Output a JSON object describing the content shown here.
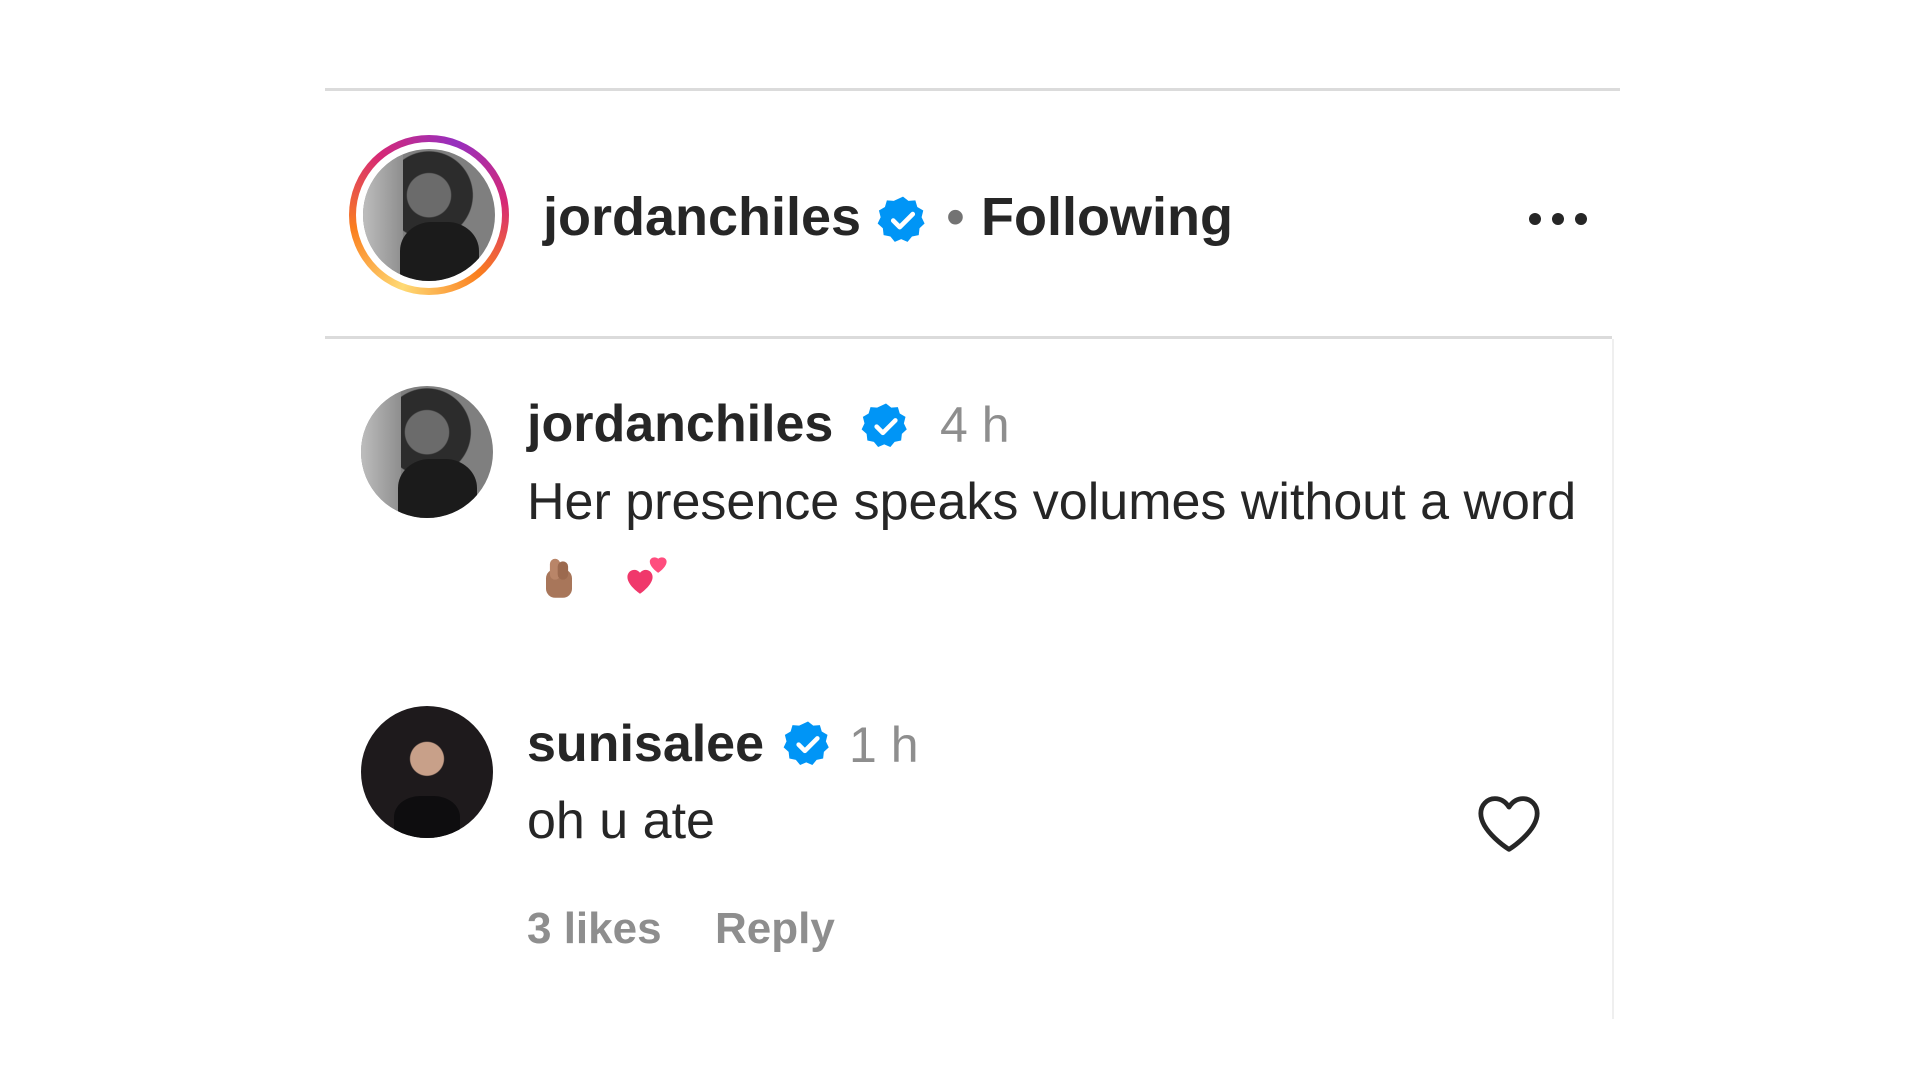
{
  "post_header": {
    "username": "jordanchiles",
    "separator": "•",
    "follow_status": "Following",
    "more_icon": "more-options-icon"
  },
  "comments": [
    {
      "username": "jordanchiles",
      "time": "4 h",
      "text": "Her presence speaks volumes without a word",
      "emojis": [
        "finger-heart-emoji",
        "two-hearts-emoji"
      ]
    },
    {
      "username": "sunisalee",
      "time": "1 h",
      "text": "oh u ate",
      "likes": "3 likes",
      "reply_label": "Reply",
      "like_icon": "heart-outline-icon"
    }
  ],
  "colors": {
    "verified": "#0095f6",
    "text": "#262626",
    "secondary": "#8e8e8e",
    "divider": "#dbdbdb"
  }
}
